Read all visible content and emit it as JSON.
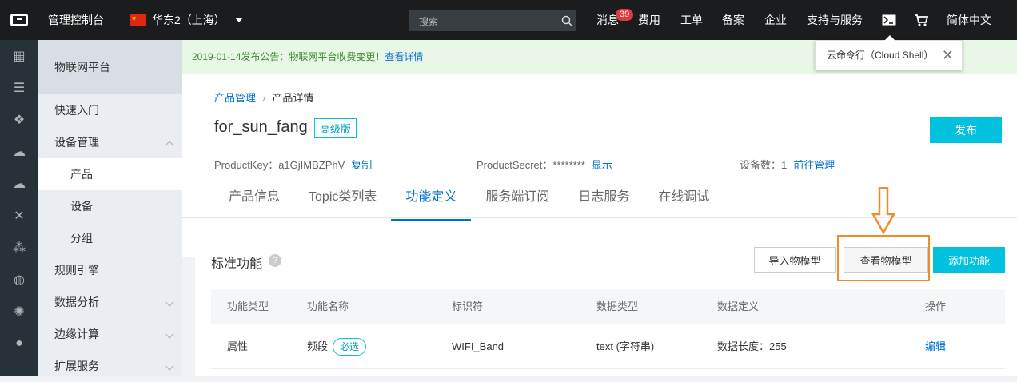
{
  "topbar": {
    "title": "管理控制台",
    "region": "华东2（上海）",
    "search_placeholder": "搜索",
    "messages": "消息",
    "messages_count": "39",
    "nav": [
      "费用",
      "工单",
      "备案",
      "企业",
      "支持与服务"
    ],
    "language": "简体中文"
  },
  "cloud_shell": {
    "label": "云命令行（Cloud Shell）"
  },
  "leftbar_icons": [
    "grid-icon",
    "database-icon",
    "gear-cube-icon",
    "cloud-icon",
    "cloud-upload-icon",
    "network-icon",
    "share-icon",
    "globe-icon",
    "bug-icon",
    "circle-icon"
  ],
  "sidebar": {
    "header": "物联网平台",
    "items": [
      {
        "label": "快速入门"
      },
      {
        "label": "设备管理"
      },
      {
        "label": "产品"
      },
      {
        "label": "设备"
      },
      {
        "label": "分组"
      },
      {
        "label": "规则引擎"
      },
      {
        "label": "数据分析"
      },
      {
        "label": "边缘计算"
      },
      {
        "label": "扩展服务"
      }
    ]
  },
  "notice": {
    "text": "2019-01-14发布公告：物联网平台收费变更！",
    "link": "查看详情"
  },
  "breadcrumb": {
    "root": "产品管理",
    "current": "产品详情"
  },
  "product": {
    "name": "for_sun_fang",
    "edition": "高级版",
    "publish": "发布",
    "key_label": "ProductKey：a1GjIMBZPhV",
    "key_action": "复制",
    "secret_label": "ProductSecret：********",
    "secret_action": "显示",
    "devices_label": "设备数：1",
    "devices_action": "前往管理"
  },
  "tabs": [
    "产品信息",
    "Topic类列表",
    "功能定义",
    "服务端订阅",
    "日志服务",
    "在线调试"
  ],
  "active_tab": "功能定义",
  "feature": {
    "title": "标准功能",
    "import_btn": "导入物模型",
    "view_btn": "查看物模型",
    "add_btn": "添加功能",
    "columns": [
      "功能类型",
      "功能名称",
      "标识符",
      "数据类型",
      "数据定义",
      "操作"
    ],
    "rows": [
      {
        "type": "属性",
        "name": "频段",
        "required": "必选",
        "identifier": "WIFI_Band",
        "data_type": "text (字符串)",
        "definition": "数据长度：255",
        "action": "编辑"
      }
    ]
  },
  "colors": {
    "accent": "#00c1de",
    "link": "#0070cc",
    "highlight": "#f08b2e",
    "topbar": "#1b1c1e"
  }
}
